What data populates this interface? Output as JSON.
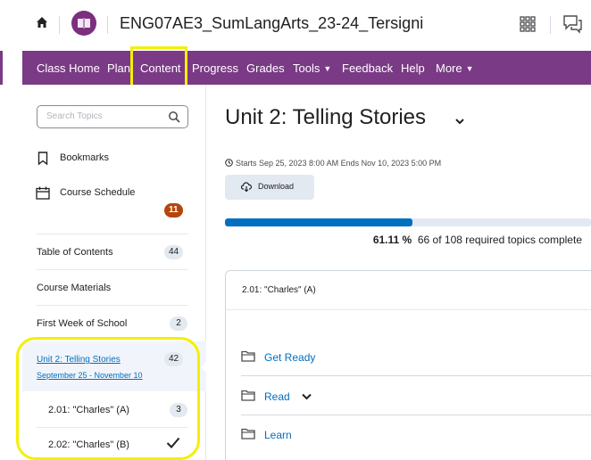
{
  "header": {
    "course_title": "ENG07AE3_SumLangArts_23-24_Tersigni",
    "icons": [
      "home-icon",
      "course-logo-icon",
      "waffle-grid-icon",
      "chat-bubble-icon"
    ]
  },
  "navbar": {
    "items": [
      {
        "label": "Class Home"
      },
      {
        "label": "Plan"
      },
      {
        "label": "Content"
      },
      {
        "label": "Progress"
      },
      {
        "label": "Grades"
      },
      {
        "label": "Tools",
        "dropdown": true
      },
      {
        "label": "Feedback"
      },
      {
        "label": "Help"
      },
      {
        "label": "More",
        "dropdown": true
      }
    ],
    "color": "#7a3a85",
    "highlighted": "Content"
  },
  "sidebar": {
    "search_placeholder": "Search Topics",
    "bookmarks": "Bookmarks",
    "course_schedule": "Course Schedule",
    "schedule_badge": "11",
    "items": [
      {
        "label": "Table of Contents",
        "count": "44"
      },
      {
        "label": "Course Materials",
        "count": ""
      },
      {
        "label": "First Week of School",
        "count": "2"
      },
      {
        "label": "Unit 2: Telling Stories",
        "sub": "September 25 - November 10",
        "count": "42",
        "selected": true
      },
      {
        "label": "2.01: \"Charles\" (A)",
        "count": "3"
      },
      {
        "label": "2.02: \"Charles\" (B)",
        "completed": true
      }
    ]
  },
  "main": {
    "unit_title": "Unit 2: Telling Stories",
    "dates": "Starts Sep 25, 2023 8:00 AM   Ends Nov 10, 2023 5:00 PM",
    "download_label": "Download",
    "progress": {
      "percent_text": "61.11 %",
      "summary": "66 of 108 required topics complete",
      "fraction": 0.6111
    },
    "topic_header": "2.01: \"Charles\" (A)",
    "modules": [
      "Get Ready",
      "Read",
      "Learn"
    ]
  },
  "colors": {
    "accent": "#7a3a85",
    "link": "#006fbf",
    "badge_orange": "#b5450b",
    "highlight": "#f3f000"
  }
}
